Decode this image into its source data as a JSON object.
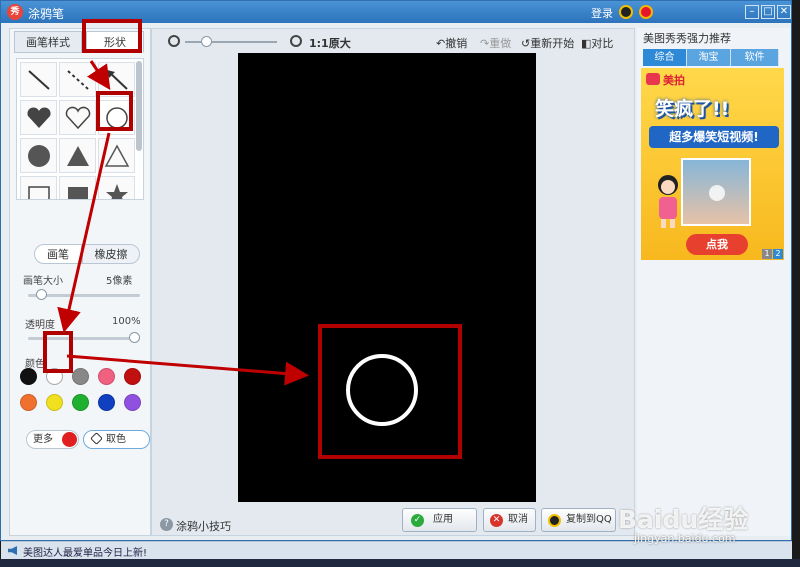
{
  "window": {
    "app_logo": "秀",
    "title": "涂鸦笔",
    "login": "登录",
    "min": "–",
    "max": "□",
    "close": "✕"
  },
  "left_panel": {
    "tabs": {
      "brush_style": "画笔样式",
      "shape": "形状"
    },
    "shapes": [
      "line",
      "dashed-line",
      "arrow",
      "heart-filled",
      "heart-outline",
      "circle-outline",
      "circle-filled",
      "triangle-filled",
      "triangle-outline",
      "square-outline",
      "square-filled",
      "star"
    ],
    "mode": {
      "brush": "画笔",
      "eraser": "橡皮擦"
    },
    "brush_size_label": "画笔大小",
    "brush_size_value": "5像素",
    "brush_size_fraction": 0.08,
    "opacity_label": "透明度",
    "opacity_value": "100%",
    "opacity_fraction": 1.0,
    "color_label": "颜色",
    "colors": [
      "#111111",
      "#ffffff",
      "#888888",
      "#f06080",
      "#c01010",
      "#f07030",
      "#f0e020",
      "#20b030",
      "#1040c0",
      "#9050e0"
    ],
    "more_label": "更多",
    "more_color": "#e02020",
    "picker_label": "取色"
  },
  "toolbar": {
    "zoom_fraction": 0.2,
    "zoom_original": "1:1原大",
    "undo": "撤销",
    "redo": "重做",
    "restart": "重新开始",
    "compare": "对比"
  },
  "bottom": {
    "tips": "涂鸦小技巧",
    "apply": "应用",
    "cancel": "取消",
    "copy": "复制到QQ"
  },
  "right_panel": {
    "title": "美图秀秀强力推荐",
    "tabs": [
      "综合",
      "淘宝",
      "软件"
    ],
    "ad": {
      "brand": "美拍",
      "headline": "笑疯了!!",
      "subline": "超多爆笑短视频!",
      "cta": "点我",
      "pages": [
        "1",
        "2"
      ]
    }
  },
  "status": {
    "text": "美图达人最爱单品今日上新!"
  },
  "watermark": {
    "main": "Baidu经验",
    "url": "jingyan.baidu.com"
  }
}
